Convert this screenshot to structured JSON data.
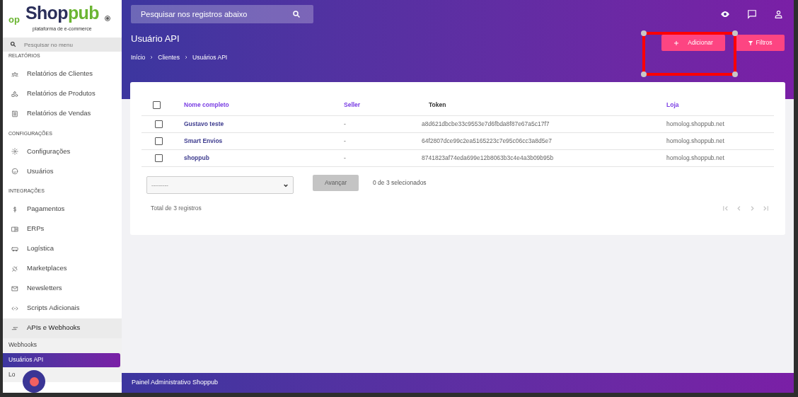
{
  "sidebar": {
    "logo": {
      "mark": "op",
      "brand_dark": "Shop",
      "brand_green": "pub",
      "tagline": "plataforma de e-commerce"
    },
    "search": {
      "placeholder": "Pesquisar no menu"
    },
    "sections": [
      {
        "title": "RELATÓRIOS",
        "items": [
          {
            "label": "Relatórios de Clientes"
          },
          {
            "label": "Relatórios de Produtos"
          },
          {
            "label": "Relatórios de Vendas"
          }
        ]
      },
      {
        "title": "CONFIGURAÇÕES",
        "items": [
          {
            "label": "Configurações"
          },
          {
            "label": "Usuários"
          }
        ]
      },
      {
        "title": "INTEGRAÇÕES",
        "items": [
          {
            "label": "Pagamentos"
          },
          {
            "label": "ERPs"
          },
          {
            "label": "Logística"
          },
          {
            "label": "Marketplaces"
          },
          {
            "label": "Newsletters"
          },
          {
            "label": "Scripts Adicionais"
          },
          {
            "label": "APIs e Webhooks",
            "expanded": true,
            "children": [
              {
                "label": "Webhooks",
                "selected": false
              },
              {
                "label": "Usuários API",
                "selected": true
              },
              {
                "label": "Lo",
                "selected": false
              }
            ]
          }
        ]
      }
    ]
  },
  "header": {
    "search": {
      "placeholder": "Pesquisar nos registros abaixo"
    },
    "title": "Usuário API",
    "breadcrumb": [
      "Início",
      "Clientes",
      "Usuários API"
    ],
    "buttons": [
      {
        "kind": "add",
        "label": "Adicionar"
      },
      {
        "kind": "filter",
        "label": "Filtros"
      }
    ]
  },
  "table": {
    "select_all": {
      "checked": false
    },
    "columns": [
      {
        "label": "Nome completo",
        "sortable": true
      },
      {
        "label": "Seller",
        "sortable": true
      },
      {
        "label": "Token",
        "sortable": false
      },
      {
        "label": "Loja",
        "sortable": true
      }
    ],
    "rows": [
      {
        "checked": false,
        "cells": [
          "Gustavo teste",
          "-",
          "a8d621dbcbe33c9553e7d6fbda8f87e67a5c17f7",
          "homolog.shoppub.net"
        ]
      },
      {
        "checked": false,
        "cells": [
          "Smart Envios",
          "-",
          "64f2807dce99c2ea5165223c7e95c06cc3a8d5e7",
          "homolog.shoppub.net"
        ]
      },
      {
        "checked": false,
        "cells": [
          "shoppub",
          "-",
          "8741823af74eda699e12b8063b3c4e4a3b09b95b",
          "homolog.shoppub.net"
        ]
      }
    ]
  },
  "bulk_action": {
    "value": "---------",
    "button": {
      "label": "Avançar",
      "disabled": true
    },
    "selection": "0 de 3 selecionados"
  },
  "total": "Total de 3 registros",
  "pagination": {
    "disabled": true
  },
  "footer": "Painel Administrativo Shoppub"
}
